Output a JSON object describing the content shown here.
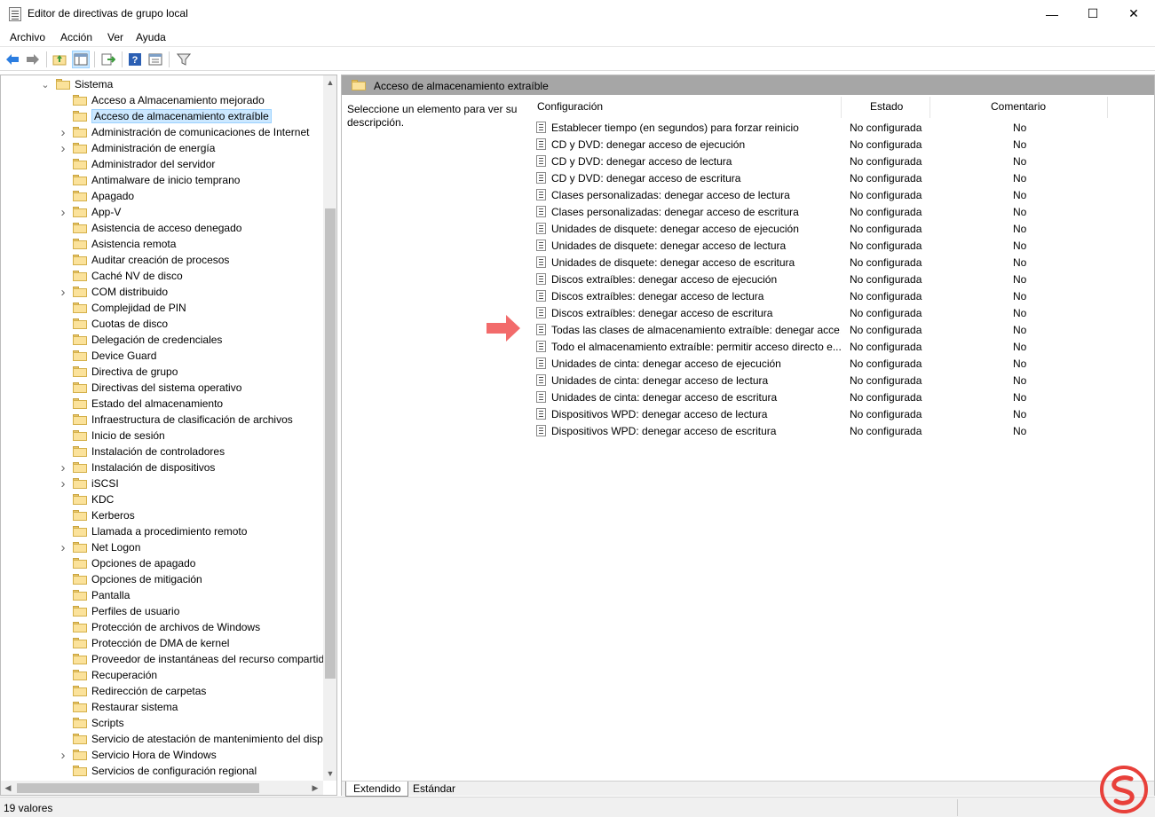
{
  "window": {
    "title": "Editor de directivas de grupo local",
    "minimize_glyph": "—",
    "maximize_glyph": "☐",
    "close_glyph": "✕"
  },
  "menu": [
    "Archivo",
    "Acción",
    "Ver",
    "Ayuda"
  ],
  "toolbar": {
    "icons": [
      "back-arrow-icon",
      "forward-arrow-icon",
      "up-folder-icon",
      "show-hide-tree-icon",
      "export-list-icon",
      "help-icon",
      "properties-icon",
      "filter-icon"
    ]
  },
  "tree": {
    "root": "Sistema",
    "items": [
      {
        "label": "Acceso a Almacenamiento mejorado",
        "expandable": false
      },
      {
        "label": "Acceso de almacenamiento extraíble",
        "expandable": false,
        "selected": true
      },
      {
        "label": "Administración de comunicaciones de Internet",
        "expandable": true
      },
      {
        "label": "Administración de energía",
        "expandable": true
      },
      {
        "label": "Administrador del servidor",
        "expandable": false
      },
      {
        "label": "Antimalware de inicio temprano",
        "expandable": false
      },
      {
        "label": "Apagado",
        "expandable": false
      },
      {
        "label": "App-V",
        "expandable": true
      },
      {
        "label": "Asistencia de acceso denegado",
        "expandable": false
      },
      {
        "label": "Asistencia remota",
        "expandable": false
      },
      {
        "label": "Auditar creación de procesos",
        "expandable": false
      },
      {
        "label": "Caché NV de disco",
        "expandable": false
      },
      {
        "label": "COM distribuido",
        "expandable": true
      },
      {
        "label": "Complejidad de PIN",
        "expandable": false
      },
      {
        "label": "Cuotas de disco",
        "expandable": false
      },
      {
        "label": "Delegación de credenciales",
        "expandable": false
      },
      {
        "label": "Device Guard",
        "expandable": false
      },
      {
        "label": "Directiva de grupo",
        "expandable": false
      },
      {
        "label": "Directivas del sistema operativo",
        "expandable": false
      },
      {
        "label": "Estado del almacenamiento",
        "expandable": false
      },
      {
        "label": "Infraestructura de clasificación de archivos",
        "expandable": false
      },
      {
        "label": "Inicio de sesión",
        "expandable": false
      },
      {
        "label": "Instalación de controladores",
        "expandable": false
      },
      {
        "label": "Instalación de dispositivos",
        "expandable": true
      },
      {
        "label": "iSCSI",
        "expandable": true
      },
      {
        "label": "KDC",
        "expandable": false
      },
      {
        "label": "Kerberos",
        "expandable": false
      },
      {
        "label": "Llamada a procedimiento remoto",
        "expandable": false
      },
      {
        "label": "Net Logon",
        "expandable": true
      },
      {
        "label": "Opciones de apagado",
        "expandable": false
      },
      {
        "label": "Opciones de mitigación",
        "expandable": false
      },
      {
        "label": "Pantalla",
        "expandable": false
      },
      {
        "label": "Perfiles de usuario",
        "expandable": false
      },
      {
        "label": "Protección de archivos de Windows",
        "expandable": false
      },
      {
        "label": "Protección de DMA de kernel",
        "expandable": false
      },
      {
        "label": "Proveedor de instantáneas del recurso compartid",
        "expandable": false
      },
      {
        "label": "Recuperación",
        "expandable": false
      },
      {
        "label": "Redirección de carpetas",
        "expandable": false
      },
      {
        "label": "Restaurar sistema",
        "expandable": false
      },
      {
        "label": "Scripts",
        "expandable": false
      },
      {
        "label": "Servicio de atestación de mantenimiento del disp",
        "expandable": false
      },
      {
        "label": "Servicio Hora de Windows",
        "expandable": true
      },
      {
        "label": "Servicios de configuración regional",
        "expandable": false
      }
    ]
  },
  "details": {
    "header": "Acceso de almacenamiento extraíble",
    "description": "Seleccione un elemento para ver su descripción.",
    "columns": {
      "name": "Configuración",
      "state": "Estado",
      "comment": "Comentario"
    },
    "rows": [
      {
        "name": "Establecer tiempo (en segundos) para forzar reinicio",
        "state": "No configurada",
        "comment": "No"
      },
      {
        "name": "CD y DVD: denegar acceso de ejecución",
        "state": "No configurada",
        "comment": "No"
      },
      {
        "name": "CD y DVD: denegar acceso de lectura",
        "state": "No configurada",
        "comment": "No"
      },
      {
        "name": "CD y DVD: denegar acceso de escritura",
        "state": "No configurada",
        "comment": "No"
      },
      {
        "name": "Clases personalizadas: denegar acceso de lectura",
        "state": "No configurada",
        "comment": "No"
      },
      {
        "name": "Clases personalizadas: denegar acceso de escritura",
        "state": "No configurada",
        "comment": "No"
      },
      {
        "name": "Unidades de disquete: denegar acceso de ejecución",
        "state": "No configurada",
        "comment": "No"
      },
      {
        "name": "Unidades de disquete: denegar acceso de lectura",
        "state": "No configurada",
        "comment": "No"
      },
      {
        "name": "Unidades de disquete: denegar acceso de escritura",
        "state": "No configurada",
        "comment": "No"
      },
      {
        "name": "Discos extraíbles: denegar acceso de ejecución",
        "state": "No configurada",
        "comment": "No"
      },
      {
        "name": "Discos extraíbles: denegar acceso de lectura",
        "state": "No configurada",
        "comment": "No"
      },
      {
        "name": "Discos extraíbles: denegar acceso de escritura",
        "state": "No configurada",
        "comment": "No"
      },
      {
        "name": "Todas las clases de almacenamiento extraíble: denegar acce...",
        "state": "No configurada",
        "comment": "No"
      },
      {
        "name": "Todo el almacenamiento extraíble: permitir acceso directo e...",
        "state": "No configurada",
        "comment": "No"
      },
      {
        "name": "Unidades de cinta: denegar acceso de ejecución",
        "state": "No configurada",
        "comment": "No"
      },
      {
        "name": "Unidades de cinta: denegar acceso de lectura",
        "state": "No configurada",
        "comment": "No"
      },
      {
        "name": "Unidades de cinta: denegar acceso de escritura",
        "state": "No configurada",
        "comment": "No"
      },
      {
        "name": "Dispositivos WPD: denegar acceso de lectura",
        "state": "No configurada",
        "comment": "No"
      },
      {
        "name": "Dispositivos WPD: denegar acceso de escritura",
        "state": "No configurada",
        "comment": "No"
      }
    ],
    "tabs": [
      "Extendido",
      "Estándar"
    ]
  },
  "status": {
    "text": "19 valores"
  },
  "colors": {
    "arrow": "#f26b6b",
    "header_bar": "#a6a6a6",
    "selection": "#cce8ff",
    "watermark": "#e8403a"
  }
}
